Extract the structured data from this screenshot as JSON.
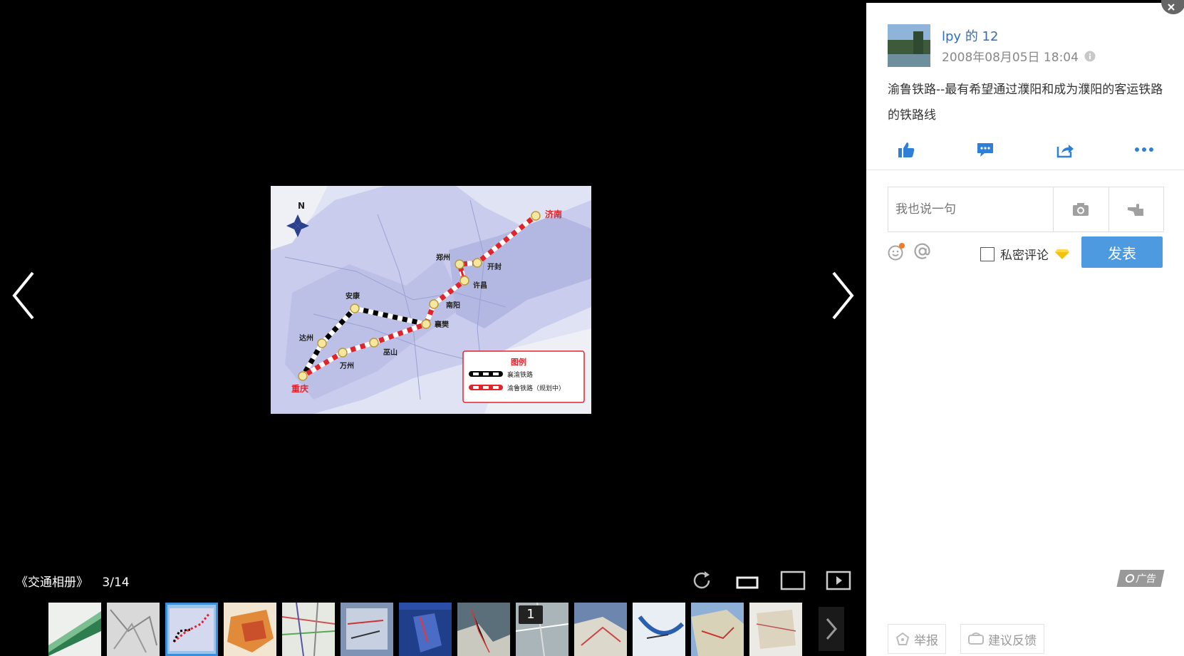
{
  "viewer": {
    "album_title": "《交通相册》",
    "counter": "3/14",
    "thumb_badge": "1"
  },
  "map": {
    "north": "N",
    "cities": [
      "济南",
      "郑州",
      "开封",
      "许昌",
      "南阳",
      "安康",
      "襄樊",
      "达州",
      "巫山",
      "万州",
      "重庆"
    ],
    "legend_title": "图例",
    "legend_items": [
      "襄渝铁路",
      "渝鲁铁路（规划中）"
    ]
  },
  "panel": {
    "user_name": "lpy",
    "user_suffix": " 的 12",
    "date": "2008年08月05日 18:04",
    "description": "渝鲁铁路--最有希望通过濮阳和成为濮阳的客运铁路的铁路线",
    "comment_placeholder": "我也说一句",
    "private_label": "私密评论",
    "publish_label": "发表",
    "ad_label": "广告",
    "report_label": "举报",
    "feedback_label": "建议反馈"
  },
  "colors": {
    "accent": "#4d9ae0",
    "rail_red": "#e0242c",
    "link_blue": "#2f6fc0"
  }
}
